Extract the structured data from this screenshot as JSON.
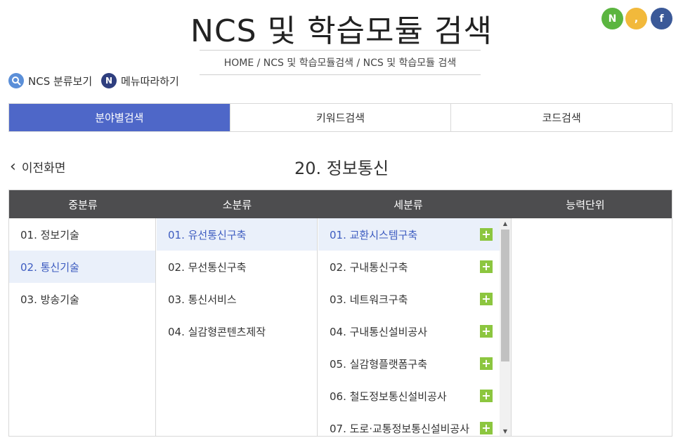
{
  "header": {
    "title": "NCS 및 학습모듈 검색",
    "breadcrumb": "HOME / NCS 및 학습모듈검색 / NCS 및 학습모듈 검색"
  },
  "social": [
    {
      "label": "N",
      "icon": "naver-icon",
      "color": "#5bb540"
    },
    {
      "label": ",",
      "icon": "kakao-story-icon",
      "color": "#f2b93b"
    },
    {
      "label": "f",
      "icon": "facebook-icon",
      "color": "#3b5998"
    }
  ],
  "quick_links": [
    {
      "label": "NCS 분류보기",
      "icon": "search-icon",
      "color": "#5b8fd8"
    },
    {
      "label": "메뉴따라하기",
      "icon": "n-badge-icon",
      "color": "#2f3f7f"
    }
  ],
  "tabs": [
    {
      "label": "분야별검색",
      "active": true
    },
    {
      "label": "키워드검색",
      "active": false
    },
    {
      "label": "코드검색",
      "active": false
    }
  ],
  "colors": {
    "accent": "#4e67c8",
    "header_bg": "#4d4d4f",
    "selected_row_bg": "#eaf0fa",
    "selected_text": "#3d5cc0",
    "plus": "#8cc63f"
  },
  "back_label": "이전화면",
  "section_title": "20. 정보통신",
  "grid": {
    "headers": [
      "중분류",
      "소분류",
      "세분류",
      "능력단위"
    ],
    "col1": [
      {
        "label": "01. 정보기술",
        "selected": false
      },
      {
        "label": "02. 통신기술",
        "selected": true
      },
      {
        "label": "03. 방송기술",
        "selected": false
      }
    ],
    "col2": [
      {
        "label": "01. 유선통신구축",
        "selected": true
      },
      {
        "label": "02. 무선통신구축",
        "selected": false
      },
      {
        "label": "03. 통신서비스",
        "selected": false
      },
      {
        "label": "04. 실감형콘텐츠제작",
        "selected": false
      }
    ],
    "col3": [
      {
        "label": "01. 교환시스템구축",
        "selected": true
      },
      {
        "label": "02. 구내통신구축",
        "selected": false
      },
      {
        "label": "03. 네트워크구축",
        "selected": false
      },
      {
        "label": "04. 구내통신설비공사",
        "selected": false
      },
      {
        "label": "05. 실감형플랫폼구축",
        "selected": false
      },
      {
        "label": "06. 철도정보통신설비공사",
        "selected": false
      },
      {
        "label": "07. 도로·교통정보통신설비공사",
        "selected": false
      }
    ],
    "plus_label": "+"
  }
}
